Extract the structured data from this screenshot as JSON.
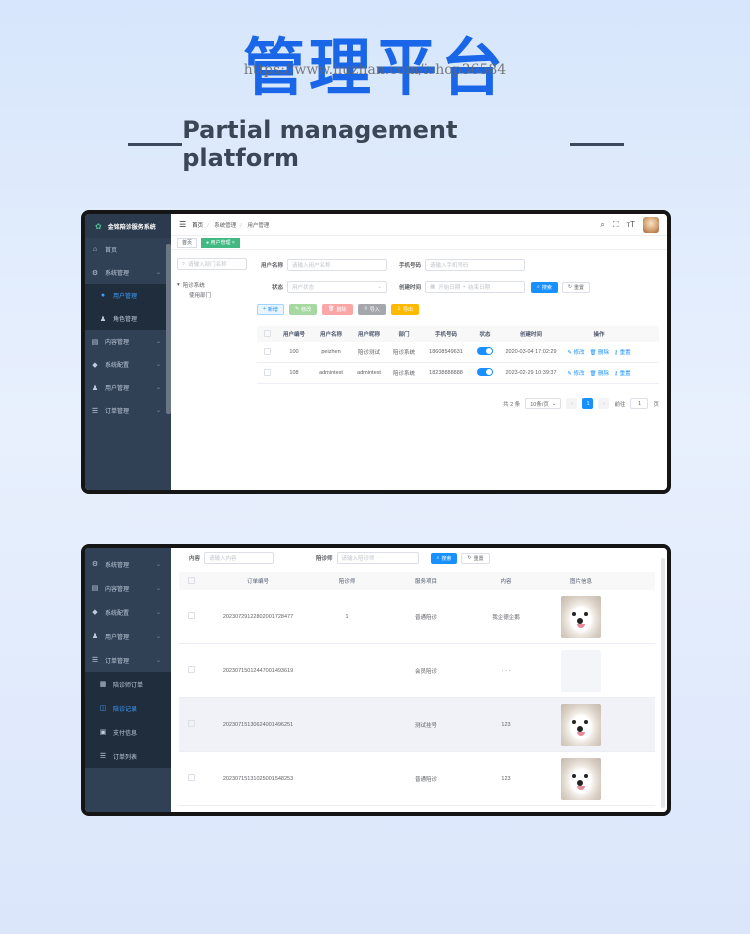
{
  "hero": {
    "title": "管理平台",
    "watermark": "https://www.huzhan.com/ishop36584",
    "subtitle": "Partial management platform"
  },
  "screen1": {
    "app_name": "金铭陪诊服务系统",
    "sidebar": [
      {
        "icon": "home-icon",
        "glyph": "⌂",
        "label": "首页",
        "chevron": false,
        "sub": false,
        "active": false
      },
      {
        "icon": "gear-icon",
        "glyph": "⚙",
        "label": "系统管理",
        "chevron": true,
        "sub": false,
        "active": false
      },
      {
        "icon": "user-icon",
        "glyph": "●",
        "label": "用户管理",
        "chevron": false,
        "sub": true,
        "active": true
      },
      {
        "icon": "role-icon",
        "glyph": "♟",
        "label": "角色管理",
        "chevron": false,
        "sub": true,
        "active": false
      },
      {
        "icon": "content-icon",
        "glyph": "▤",
        "label": "内容管理",
        "chevron": true,
        "sub": false,
        "active": false
      },
      {
        "icon": "config-icon",
        "glyph": "◆",
        "label": "系统配置",
        "chevron": true,
        "sub": false,
        "active": false
      },
      {
        "icon": "users-icon",
        "glyph": "♟",
        "label": "用户管理",
        "chevron": true,
        "sub": false,
        "active": false
      },
      {
        "icon": "list-icon",
        "glyph": "☰",
        "label": "订单管理",
        "chevron": true,
        "sub": false,
        "active": false
      }
    ],
    "breadcrumb": [
      "首页",
      "系统管理",
      "用户管理"
    ],
    "tag": "用户管理",
    "tree_search_placeholder": "请输入部门名称",
    "tree": {
      "root": "陪诊系统",
      "child": "使用部门"
    },
    "filters": {
      "username_label": "用户名称",
      "username_placeholder": "请输入用户名称",
      "phone_label": "手机号码",
      "phone_placeholder": "请输入手机号码",
      "status_label": "状态",
      "status_placeholder": "用户状态",
      "created_label": "创建时间",
      "start_placeholder": "开始日期",
      "end_placeholder": "结束日期",
      "search_btn": "搜索",
      "reset_btn": "重置"
    },
    "actions": {
      "add": "新增",
      "edit": "修改",
      "delete": "删除",
      "import": "导入",
      "export": "导出"
    },
    "table": {
      "headers": [
        "用户编号",
        "用户名称",
        "用户昵称",
        "部门",
        "手机号码",
        "状态",
        "创建时间",
        "操作"
      ],
      "rows": [
        {
          "id": "100",
          "name": "peizhen",
          "nick": "陪诊测试",
          "dept": "陪诊系统",
          "phone": "18608549631",
          "time": "2020-03-04 17:02:29"
        },
        {
          "id": "108",
          "name": "admintest",
          "nick": "admintest",
          "dept": "陪诊系统",
          "phone": "18238888888",
          "time": "2023-02-29 10:39:37"
        }
      ],
      "op_edit": "修改",
      "op_delete": "删除",
      "op_reset": "重置"
    },
    "pager": {
      "total": "共 2 条",
      "size": "10条/页",
      "page": "1",
      "goto_label": "前往",
      "goto_value": "1",
      "page_unit": "页"
    }
  },
  "screen2": {
    "sidebar": [
      {
        "icon": "gear-icon",
        "glyph": "⚙",
        "label": "系统管理",
        "chevron": true,
        "sub": false,
        "active": false
      },
      {
        "icon": "content-icon",
        "glyph": "▤",
        "label": "内容管理",
        "chevron": true,
        "sub": false,
        "active": false
      },
      {
        "icon": "config-icon",
        "glyph": "◆",
        "label": "系统配置",
        "chevron": true,
        "sub": false,
        "active": false
      },
      {
        "icon": "users-icon",
        "glyph": "♟",
        "label": "用户管理",
        "chevron": true,
        "sub": false,
        "active": false
      },
      {
        "icon": "list-icon",
        "glyph": "☰",
        "label": "订单管理",
        "chevron": true,
        "sub": false,
        "active": false
      },
      {
        "icon": "order-icon",
        "glyph": "▦",
        "label": "陪诊师订单",
        "chevron": false,
        "sub": true,
        "active": false
      },
      {
        "icon": "record-icon",
        "glyph": "◫",
        "label": "陪诊记录",
        "chevron": false,
        "sub": true,
        "active": true
      },
      {
        "icon": "pay-icon",
        "glyph": "▣",
        "label": "支付信息",
        "chevron": false,
        "sub": true,
        "active": false
      },
      {
        "icon": "orderlist-icon",
        "glyph": "☰",
        "label": "订单列表",
        "chevron": false,
        "sub": true,
        "active": false
      }
    ],
    "filters": {
      "content_label": "内容",
      "content_placeholder": "请输入内容",
      "escort_label": "陪诊师",
      "escort_placeholder": "请输入陪诊师",
      "search_btn": "搜索",
      "reset_btn": "重置"
    },
    "table": {
      "headers": [
        "订单编号",
        "陪诊师",
        "服务项目",
        "内容",
        "图片信息"
      ],
      "rows": [
        {
          "order": "20230729122802001728477",
          "escort": "1",
          "service": "普通陪诊",
          "content": "我企德企鹅",
          "highlight": false,
          "faint": false
        },
        {
          "order": "20230715012447001493619",
          "escort": "",
          "service": "会员陪诊",
          "content": "· · ·",
          "highlight": false,
          "faint": true
        },
        {
          "order": "20230715130624001496251",
          "escort": "",
          "service": "测试挂号",
          "content": "123",
          "highlight": true,
          "faint": false
        },
        {
          "order": "20230715131025001548253",
          "escort": "",
          "service": "普通陪诊",
          "content": "123",
          "highlight": false,
          "faint": false
        }
      ]
    }
  }
}
